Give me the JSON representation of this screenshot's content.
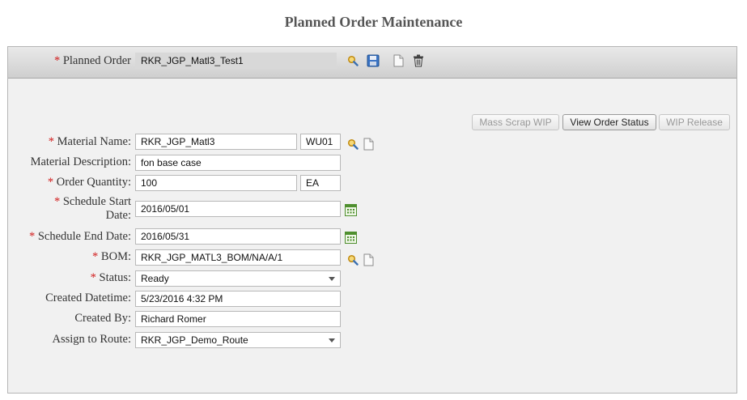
{
  "page": {
    "title": "Planned Order Maintenance"
  },
  "toolbar": {
    "planned_order_label": "Planned Order",
    "planned_order_value": "RKR_JGP_Matl3_Test1"
  },
  "actions": {
    "mass_scrap": "Mass Scrap WIP",
    "view_status": "View Order Status",
    "wip_release": "WIP Release"
  },
  "form": {
    "material_name_label": "Material Name:",
    "material_name": "RKR_JGP_Matl3",
    "material_rev": "WU01",
    "material_desc_label": "Material Description:",
    "material_desc": "fon base case",
    "order_qty_label": "Order Quantity:",
    "order_qty": "100",
    "order_uom": "EA",
    "start_date_label_1": "Schedule Start",
    "start_date_label_2": "Date:",
    "start_date": "2016/05/01",
    "end_date_label": "Schedule End Date:",
    "end_date": "2016/05/31",
    "bom_label": "BOM:",
    "bom": "RKR_JGP_MATL3_BOM/NA/A/1",
    "status_label": "Status:",
    "status": "Ready",
    "created_dt_label": "Created Datetime:",
    "created_dt": "5/23/2016 4:32 PM",
    "created_by_label": "Created By:",
    "created_by": "Richard Romer",
    "route_label": "Assign to Route:",
    "route": "RKR_JGP_Demo_Route"
  },
  "required_mark": "*"
}
